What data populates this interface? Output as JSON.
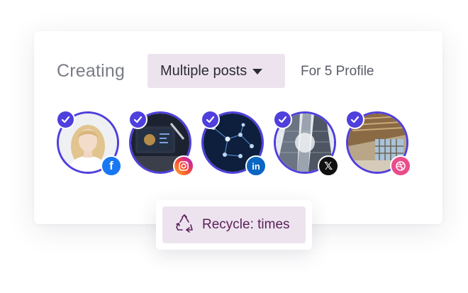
{
  "header": {
    "creating_label": "Creating",
    "post_type_value": "Multiple posts",
    "profile_count_text": "For 5 Profile"
  },
  "profiles": [
    {
      "network": "Facebook",
      "badge_glyph": "f",
      "badge_color": "#1877f2",
      "selected": true,
      "icon": "facebook-icon"
    },
    {
      "network": "Instagram",
      "badge_glyph": "",
      "badge_color": "#d32b8d",
      "selected": true,
      "icon": "instagram-icon"
    },
    {
      "network": "LinkedIn",
      "badge_glyph": "in",
      "badge_color": "#0a66c2",
      "selected": true,
      "icon": "linkedin-icon"
    },
    {
      "network": "X",
      "badge_glyph": "𝕏",
      "badge_color": "#111111",
      "selected": true,
      "icon": "x-icon"
    },
    {
      "network": "Dribbble",
      "badge_glyph": "",
      "badge_color": "#ea4c89",
      "selected": true,
      "icon": "dribbble-icon"
    }
  ],
  "recycle": {
    "label": "Recycle: times",
    "icon": "recycle-icon"
  },
  "colors": {
    "accent": "#4f3fdc",
    "chip_background": "#ece3ef",
    "recycle_text": "#5b1f58"
  }
}
